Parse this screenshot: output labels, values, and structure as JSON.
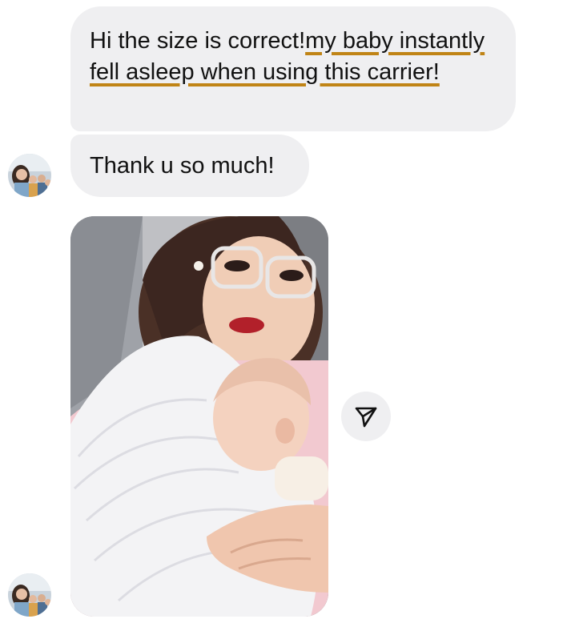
{
  "messages": [
    {
      "sender": "other",
      "parts": [
        {
          "text": "Hi the size is correct!",
          "highlight": false
        },
        {
          "text": "my baby instantly fell asleep when using this carrier!",
          "highlight": true
        }
      ]
    },
    {
      "sender": "other",
      "text": "Thank u so much!"
    },
    {
      "sender": "other",
      "type": "photo",
      "alt": "Mother holding sleeping baby in white wrap carrier"
    }
  ],
  "icons": {
    "share": "send-arrow-icon",
    "avatar": "profile-avatar"
  },
  "colors": {
    "bubble_bg": "#efeff1",
    "text": "#111111",
    "highlight_underline": "#c08416",
    "background": "#ffffff"
  }
}
